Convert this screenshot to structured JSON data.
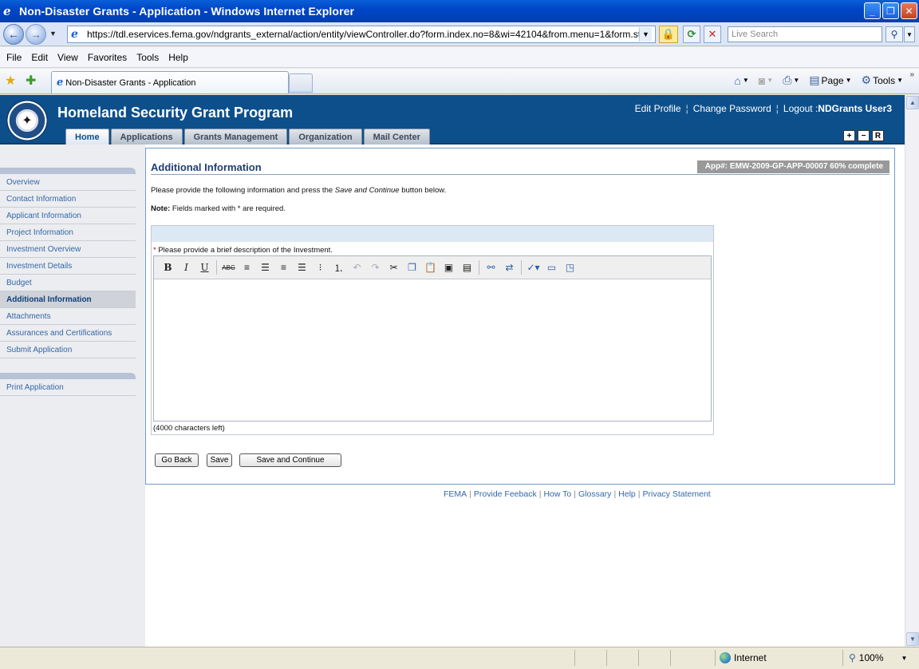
{
  "window": {
    "title": "Non-Disaster Grants - Application - Windows Internet Explorer"
  },
  "address": {
    "url": "https://tdl.eservices.fema.gov/ndgrants_external/action/entity/viewController.do?form.index.no=8&wi=42104&from.menu=1&form.status=Not",
    "search_placeholder": "Live Search"
  },
  "menu": [
    "File",
    "Edit",
    "View",
    "Favorites",
    "Tools",
    "Help"
  ],
  "browser_tab": {
    "title": "Non-Disaster Grants - Application"
  },
  "commands": {
    "page": "Page",
    "tools": "Tools"
  },
  "site": {
    "title": "Homeland Security Grant Program",
    "links": {
      "edit_profile": "Edit Profile",
      "change_password": "Change Password",
      "logout": "Logout :",
      "user": "NDGrants User3"
    },
    "tabs": [
      "Home",
      "Applications",
      "Grants Management",
      "Organization",
      "Mail Center"
    ],
    "active_tab": "Home",
    "zoom_buttons": [
      "+",
      "−",
      "R"
    ]
  },
  "leftnav": {
    "items": [
      "Overview",
      "Contact Information",
      "Applicant Information",
      "Project Information",
      "Investment Overview",
      "Investment Details",
      "Budget",
      "Additional Information",
      "Attachments",
      "Assurances and Certifications",
      "Submit Application"
    ],
    "active": "Additional Information",
    "print": "Print Application"
  },
  "main": {
    "title": "Additional Information",
    "badge": "App#: EMW-2009-GP-APP-00007 60% complete",
    "intro_before": "Please provide the following information and press the ",
    "intro_em": "Save and Continue",
    "intro_after": " button below.",
    "note_label": "Note:",
    "note_text": " Fields marked with * are required.",
    "field_required": "*",
    "field_label": " Please provide a brief description of the Investment.",
    "chars_left": "(4000 characters left)",
    "buttons": {
      "back": "Go Back",
      "save": "Save",
      "save_continue": "Save and Continue"
    }
  },
  "footer": [
    "FEMA",
    "Provide Feeback",
    "How To",
    "Glossary",
    "Help",
    "Privacy Statement"
  ],
  "status": {
    "zone": "Internet",
    "zoom": "100%"
  }
}
